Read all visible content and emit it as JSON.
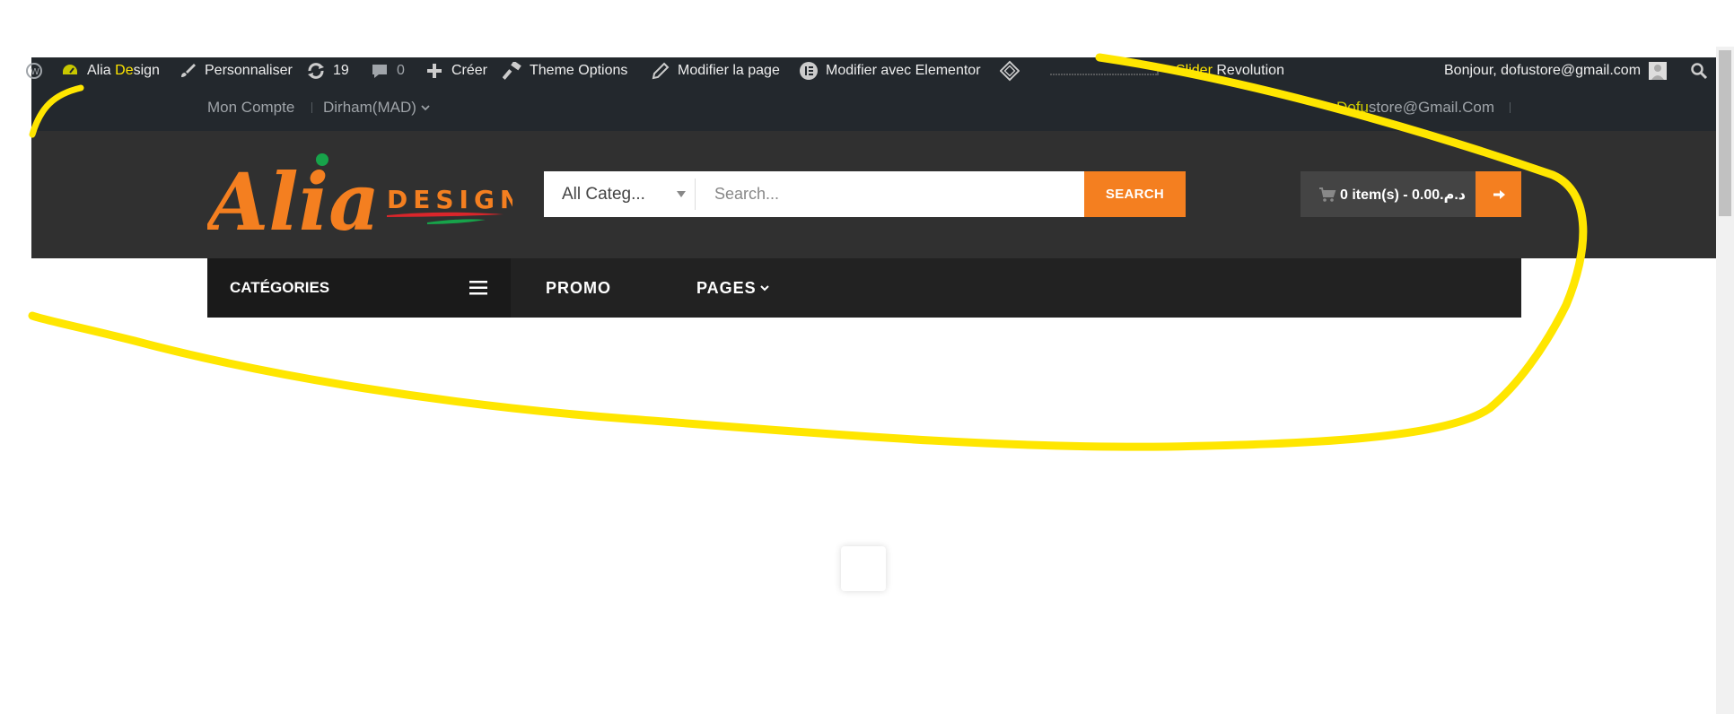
{
  "adminbar": {
    "site_name_part1": "Alia",
    "site_name_part2": "De",
    "site_name_part3": "sign",
    "customize": "Personnaliser",
    "updates_count": "19",
    "comments_count": "0",
    "create": "Créer",
    "theme_options": "Theme Options",
    "edit_page": "Modifier la page",
    "edit_elementor": "Modifier avec Elementor",
    "slider_part1": "Slider",
    "slider_part2": "Revolution",
    "greeting": "Bonjour, dofustore@gmail.com"
  },
  "topbar": {
    "account": "Mon Compte",
    "currency": "Dirham(MAD)",
    "email_part1": "Dofu",
    "email_part2": "store@Gmail.Com"
  },
  "header": {
    "logo_main": "Alia",
    "logo_sub": "DESIGN",
    "category_select": "All Categ...",
    "search_placeholder": "Search...",
    "search_button": "SEARCH",
    "cart_summary": "0 item(s) - 0.00.د.م"
  },
  "menu": {
    "categories": "CATÉGORIES",
    "promo": "PROMO",
    "pages": "PAGES"
  },
  "colors": {
    "accent": "#f47f20",
    "annotation": "#ffe600",
    "dark_bg": "#23282d",
    "header_bg": "#303030"
  }
}
